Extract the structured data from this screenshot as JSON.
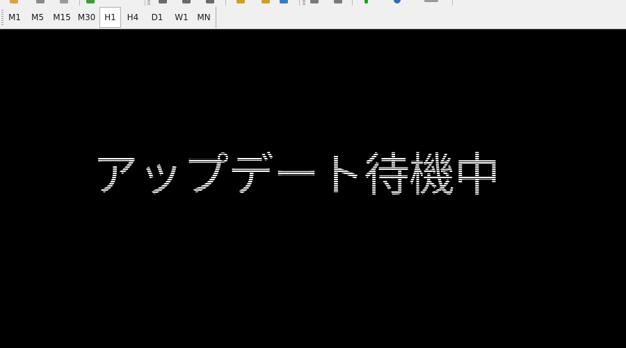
{
  "timeframes": {
    "items": [
      {
        "id": "m1",
        "label": "M1"
      },
      {
        "id": "m5",
        "label": "M5"
      },
      {
        "id": "m15",
        "label": "M15"
      },
      {
        "id": "m30",
        "label": "M30"
      },
      {
        "id": "h1",
        "label": "H1"
      },
      {
        "id": "h4",
        "label": "H4"
      },
      {
        "id": "d1",
        "label": "D1"
      },
      {
        "id": "w1",
        "label": "W1"
      },
      {
        "id": "mn",
        "label": "MN"
      }
    ],
    "active": "H1"
  },
  "chart": {
    "status_text": "アップデート待機中",
    "background_color": "#000000",
    "text_color": "#ffffff"
  },
  "colors": {
    "toolbar_bg": "#f0f0f0",
    "icon_green": "#1aa31a",
    "icon_blue": "#2f6db5"
  }
}
